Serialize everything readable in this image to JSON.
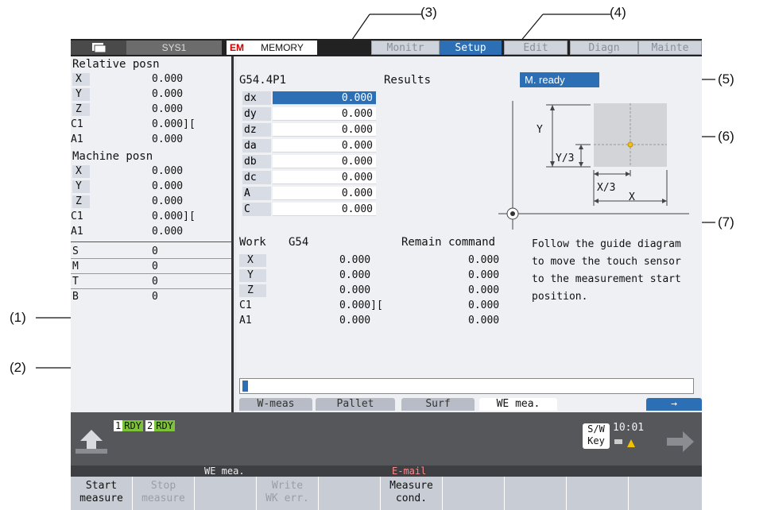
{
  "annotations": {
    "a1": "(1)",
    "a2": "(2)",
    "a3": "(3)",
    "a4": "(4)",
    "a5": "(5)",
    "a6": "(6)",
    "a7": "(7)"
  },
  "topbar": {
    "system": "SYS1",
    "em": "EM",
    "mode": "MEMORY",
    "tabs": [
      "Monitr",
      "Setup",
      "Edit",
      "Diagn",
      "Mainte"
    ],
    "active_tab": "Setup"
  },
  "left": {
    "relative_title": "Relative posn",
    "relative": [
      [
        "X",
        "0.000"
      ],
      [
        "Y",
        "0.000"
      ],
      [
        "Z",
        "0.000"
      ],
      [
        "C1",
        "0.000]["
      ],
      [
        "A1",
        "0.000"
      ]
    ],
    "machine_title": "Machine posn",
    "machine": [
      [
        "X",
        "0.000"
      ],
      [
        "Y",
        "0.000"
      ],
      [
        "Z",
        "0.000"
      ],
      [
        "C1",
        "0.000]["
      ],
      [
        "A1",
        "0.000"
      ]
    ],
    "smtb": [
      [
        "S",
        "0"
      ],
      [
        "M",
        "0"
      ],
      [
        "T",
        "0"
      ],
      [
        "B",
        "0"
      ]
    ]
  },
  "main": {
    "title": "G54.4P1",
    "results_label": "Results",
    "status": "M. ready",
    "results": [
      [
        "dx",
        "0.000"
      ],
      [
        "dy",
        "0.000"
      ],
      [
        "dz",
        "0.000"
      ],
      [
        "da",
        "0.000"
      ],
      [
        "db",
        "0.000"
      ],
      [
        "dc",
        "0.000"
      ],
      [
        "A",
        "0.000"
      ],
      [
        "C",
        "0.000"
      ]
    ],
    "diagram": {
      "y": "Y",
      "y3": "Y/3",
      "x3": "X/3",
      "x": "X"
    },
    "work_label": "Work",
    "work_coord": "G54",
    "remain_label": "Remain command",
    "work": [
      [
        "X",
        "0.000",
        "0.000"
      ],
      [
        "Y",
        "0.000",
        "0.000"
      ],
      [
        "Z",
        "0.000",
        "0.000"
      ],
      [
        "C1",
        "0.000][",
        "0.000"
      ],
      [
        "A1",
        "0.000",
        "0.000"
      ]
    ],
    "guide": "Follow the guide diagram to move the touch sensor to the measurement start position.",
    "bottom_tabs": [
      "W-meas",
      "Pallet",
      "Surf",
      "WE mea."
    ],
    "arrow_tab": "→"
  },
  "status": {
    "rdy1_n": "1",
    "rdy1_t": "RDY",
    "rdy2_n": "2",
    "rdy2_t": "RDY",
    "sw": "S/W",
    "key": "Key",
    "time": "10:01",
    "mode_label": "WE mea.",
    "mail": "E-mail"
  },
  "fkeys": [
    {
      "l1": "Start",
      "l2": "measure",
      "on": true
    },
    {
      "l1": "Stop",
      "l2": "measure",
      "on": false
    },
    {
      "l1": "",
      "l2": "",
      "on": false
    },
    {
      "l1": "Write",
      "l2": "WK err.",
      "on": false
    },
    {
      "l1": "",
      "l2": "",
      "on": false
    },
    {
      "l1": "Measure",
      "l2": "cond.",
      "on": true
    },
    {
      "l1": "",
      "l2": "",
      "on": false
    },
    {
      "l1": "",
      "l2": "",
      "on": false
    },
    {
      "l1": "",
      "l2": "",
      "on": false
    },
    {
      "l1": "",
      "l2": "",
      "on": false
    }
  ],
  "colors": {
    "accent": "#2d6fb4",
    "rdy": "#7ec23a",
    "em": "#d00000"
  }
}
